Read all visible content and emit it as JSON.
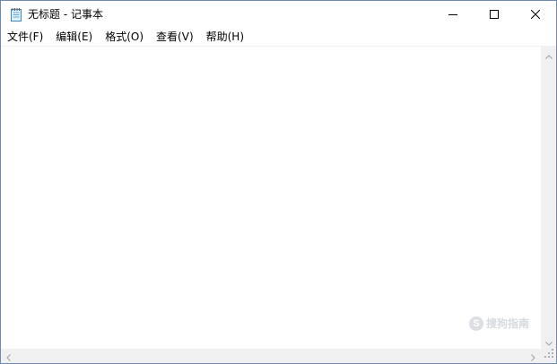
{
  "window": {
    "title": "无标题 - 记事本",
    "app_icon": "notepad-icon"
  },
  "controls": {
    "minimize_icon": "minimize-icon",
    "maximize_icon": "maximize-icon",
    "close_icon": "close-icon"
  },
  "menu": {
    "items": [
      {
        "label": "文件(F)"
      },
      {
        "label": "编辑(E)"
      },
      {
        "label": "格式(O)"
      },
      {
        "label": "查看(V)"
      },
      {
        "label": "帮助(H)"
      }
    ]
  },
  "editor": {
    "content": ""
  },
  "watermark": {
    "mark": "S",
    "text": "搜狗指南"
  },
  "colors": {
    "border": "#6e8ab3",
    "scrollbar": "#f0f0f0",
    "arrow": "#a0a0a0"
  }
}
